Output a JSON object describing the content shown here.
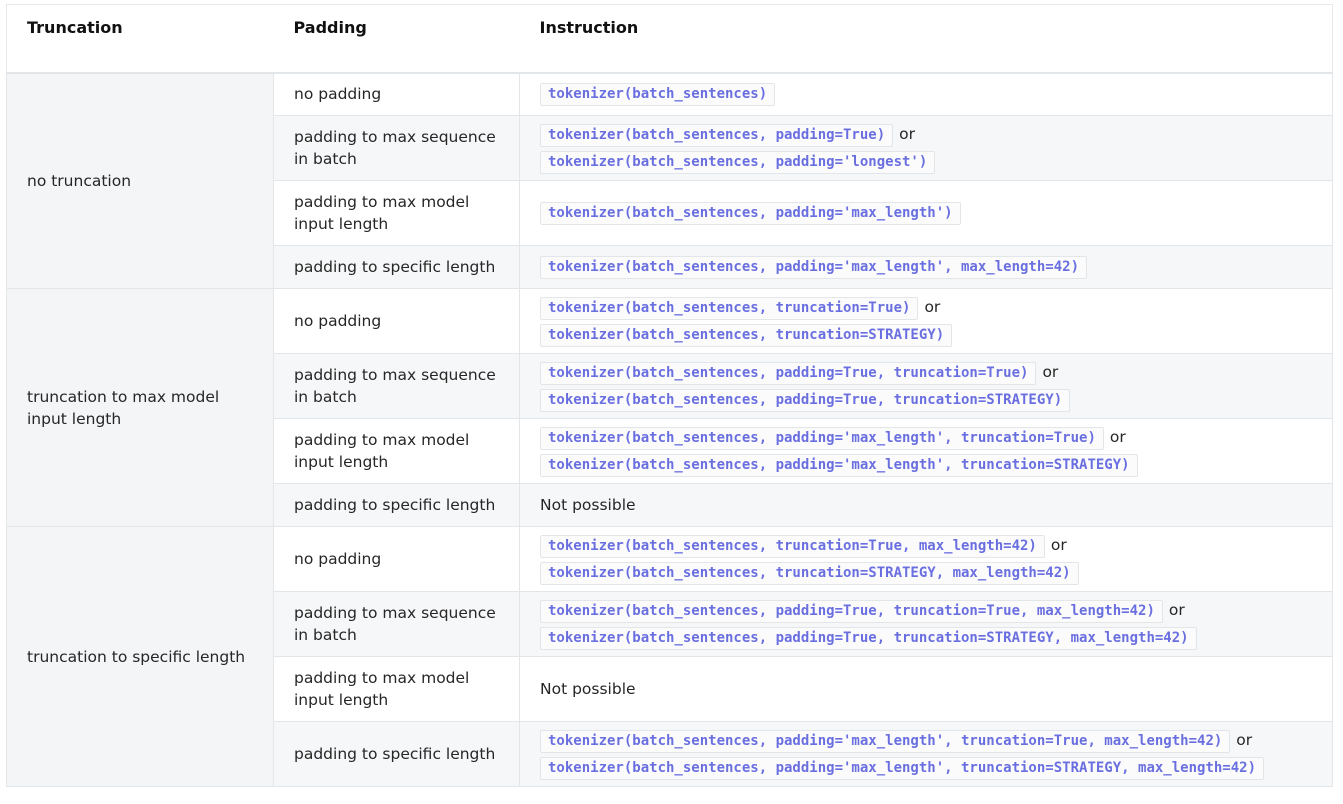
{
  "headers": [
    "Truncation",
    "Padding",
    "Instruction"
  ],
  "groups": [
    {
      "truncation": "no truncation",
      "rows": [
        {
          "padding": "no padding",
          "lines": [
            {
              "code": "tokenizer(batch_sentences)",
              "or": ""
            }
          ],
          "text": ""
        },
        {
          "padding": "padding to max sequence in batch",
          "lines": [
            {
              "code": "tokenizer(batch_sentences, padding=True)",
              "or": "or"
            },
            {
              "code": "tokenizer(batch_sentences, padding='longest')",
              "or": ""
            }
          ],
          "text": ""
        },
        {
          "padding": "padding to max model input length",
          "lines": [
            {
              "code": "tokenizer(batch_sentences, padding='max_length')",
              "or": ""
            }
          ],
          "text": ""
        },
        {
          "padding": "padding to specific length",
          "lines": [
            {
              "code": "tokenizer(batch_sentences, padding='max_length', max_length=42)",
              "or": ""
            }
          ],
          "text": ""
        }
      ]
    },
    {
      "truncation": "truncation to max model input length",
      "rows": [
        {
          "padding": "no padding",
          "lines": [
            {
              "code": "tokenizer(batch_sentences, truncation=True)",
              "or": "or"
            },
            {
              "code": "tokenizer(batch_sentences, truncation=STRATEGY)",
              "or": ""
            }
          ],
          "text": ""
        },
        {
          "padding": "padding to max sequence in batch",
          "lines": [
            {
              "code": "tokenizer(batch_sentences, padding=True, truncation=True)",
              "or": "or"
            },
            {
              "code": "tokenizer(batch_sentences, padding=True, truncation=STRATEGY)",
              "or": ""
            }
          ],
          "text": ""
        },
        {
          "padding": "padding to max model input length",
          "lines": [
            {
              "code": "tokenizer(batch_sentences, padding='max_length', truncation=True)",
              "or": "or"
            },
            {
              "code": "tokenizer(batch_sentences, padding='max_length', truncation=STRATEGY)",
              "or": ""
            }
          ],
          "text": ""
        },
        {
          "padding": "padding to specific length",
          "lines": [],
          "text": "Not possible"
        }
      ]
    },
    {
      "truncation": "truncation to specific length",
      "rows": [
        {
          "padding": "no padding",
          "lines": [
            {
              "code": "tokenizer(batch_sentences, truncation=True, max_length=42)",
              "or": "or"
            },
            {
              "code": "tokenizer(batch_sentences, truncation=STRATEGY, max_length=42)",
              "or": ""
            }
          ],
          "text": ""
        },
        {
          "padding": "padding to max sequence in batch",
          "lines": [
            {
              "code": "tokenizer(batch_sentences, padding=True, truncation=True, max_length=42)",
              "or": "or"
            },
            {
              "code": "tokenizer(batch_sentences, padding=True, truncation=STRATEGY, max_length=42)",
              "or": ""
            }
          ],
          "text": ""
        },
        {
          "padding": "padding to max model input length",
          "lines": [],
          "text": "Not possible"
        },
        {
          "padding": "padding to specific length",
          "lines": [
            {
              "code": "tokenizer(batch_sentences, padding='max_length', truncation=True, max_length=42)",
              "or": "or"
            },
            {
              "code": "tokenizer(batch_sentences, padding='max_length', truncation=STRATEGY, max_length=42)",
              "or": ""
            }
          ],
          "text": ""
        }
      ]
    }
  ]
}
